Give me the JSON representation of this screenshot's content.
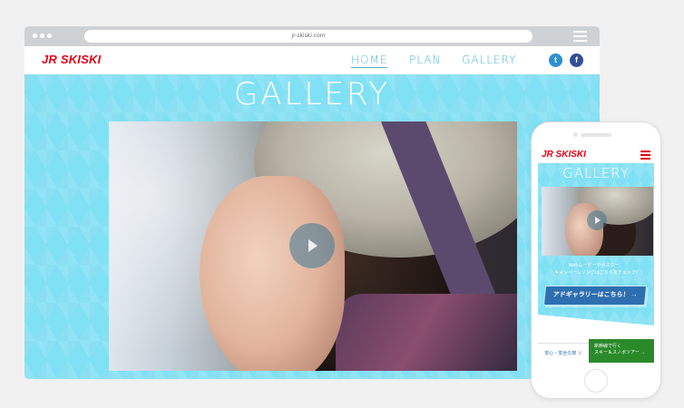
{
  "browser": {
    "url": "jr-skiski.com"
  },
  "site": {
    "logo": "JR SKISKI",
    "nav": {
      "home": "HOME",
      "plan": "PLAN",
      "gallery": "GALLERY"
    },
    "social": {
      "twitter_glyph": "t",
      "facebook_glyph": "f"
    },
    "section_title": "GALLERY"
  },
  "phone": {
    "logo": "JR SKISKI",
    "section_title": "GALLERY",
    "caption_line1": "Webムービーやポスター、",
    "caption_line2": "キャンペーンソングはこちらをチェック!",
    "cta": "アドギャラリーはこちら！ →",
    "safety": "安心・安全の旅 ∨",
    "shinkansen_line1": "新幹線で行く",
    "shinkansen_line2": "スキー＆スノボツアー →"
  },
  "colors": {
    "accent_red": "#e60012",
    "sky_blue": "#80e0f4",
    "nav_blue": "#4fb6d4"
  },
  "icons": [
    "menu-icon",
    "twitter-icon",
    "facebook-icon",
    "play-icon"
  ]
}
